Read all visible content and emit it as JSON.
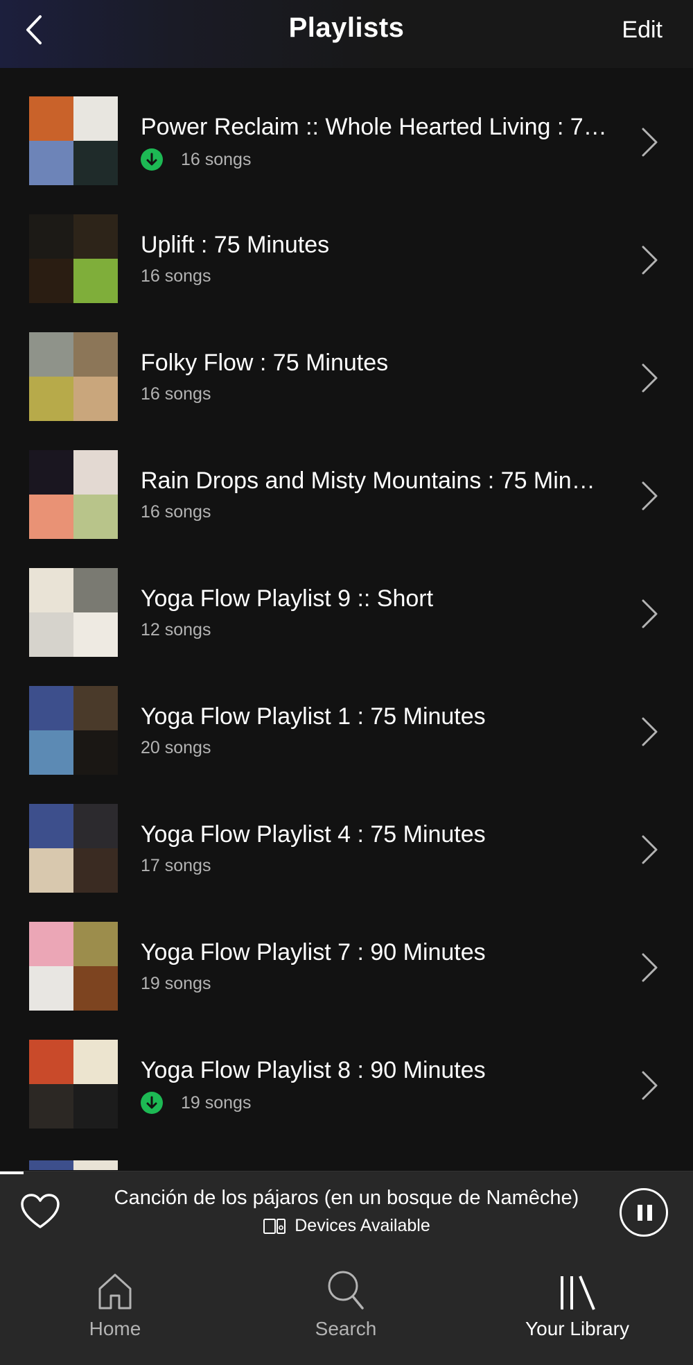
{
  "header": {
    "title": "Playlists",
    "edit_label": "Edit"
  },
  "playlists": [
    {
      "title": "Power Reclaim :: Whole Hearted Living : 7…",
      "songs": "16 songs",
      "downloaded": true,
      "covers": [
        "#c9622a",
        "#e8e6e0",
        "#6d84b8",
        "#1f2b2a"
      ]
    },
    {
      "title": "Uplift : 75 Minutes",
      "songs": "16 songs",
      "downloaded": false,
      "covers": [
        "#1c1a16",
        "#2d2419",
        "#2a1d12",
        "#7fae3a"
      ]
    },
    {
      "title": "Folky Flow : 75 Minutes",
      "songs": "16 songs",
      "downloaded": false,
      "covers": [
        "#8f938a",
        "#8c7658",
        "#b7aa4a",
        "#c9a67c"
      ]
    },
    {
      "title": "Rain Drops and Misty Mountains : 75 Min…",
      "songs": "16 songs",
      "downloaded": false,
      "covers": [
        "#1a1620",
        "#e3d9d2",
        "#e99275",
        "#b8c48a"
      ]
    },
    {
      "title": "Yoga Flow Playlist 9 :: Short",
      "songs": "12 songs",
      "downloaded": false,
      "covers": [
        "#e9e3d6",
        "#7a7a72",
        "#d6d3cc",
        "#eeeae2"
      ]
    },
    {
      "title": "Yoga Flow Playlist 1 : 75 Minutes",
      "songs": "20 songs",
      "downloaded": false,
      "covers": [
        "#3d4f8c",
        "#4a3a2a",
        "#5c8ab4",
        "#1a1714"
      ]
    },
    {
      "title": "Yoga Flow Playlist 4 : 75 Minutes",
      "songs": "17 songs",
      "downloaded": false,
      "covers": [
        "#3d4f8c",
        "#2c2a2e",
        "#d8c8ae",
        "#3a2b22"
      ]
    },
    {
      "title": "Yoga Flow Playlist 7 : 90 Minutes",
      "songs": "19 songs",
      "downloaded": false,
      "covers": [
        "#eba6b6",
        "#9c8d4c",
        "#e8e6e2",
        "#7d4420"
      ]
    },
    {
      "title": "Yoga Flow Playlist 8 : 90 Minutes",
      "songs": "19 songs",
      "downloaded": true,
      "covers": [
        "#c94a2a",
        "#ece4cf",
        "#2c2824",
        "#1c1c1c"
      ]
    }
  ],
  "partial_covers": [
    "#3d4f8c",
    "#e9e3d6"
  ],
  "player": {
    "track": "Canción de los pájaros (en un bosque de Namêche)",
    "devices_label": "Devices Available"
  },
  "tabs": [
    {
      "label": "Home"
    },
    {
      "label": "Search"
    },
    {
      "label": "Your Library"
    }
  ],
  "colors": {
    "accent": "#1db954",
    "background": "#121212",
    "bar": "#282828"
  }
}
